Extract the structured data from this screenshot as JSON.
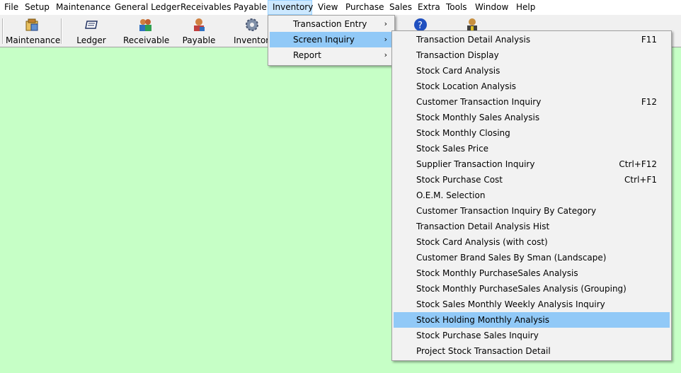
{
  "menubar": {
    "items": [
      "File",
      "Setup",
      "Maintenance",
      "General Ledger",
      "Receivables",
      "Payable",
      "Inventory",
      "View",
      "Purchase",
      "Sales",
      "Extra",
      "Tools",
      "Window",
      "Help"
    ],
    "active": "Inventory"
  },
  "toolbar": {
    "buttons": [
      {
        "label": "Maintenance",
        "icon": "maintenance-icon"
      },
      {
        "label": "Ledger",
        "icon": "ledger-icon"
      },
      {
        "label": "Receivable",
        "icon": "receivable-icon"
      },
      {
        "label": "Payable",
        "icon": "payable-icon"
      },
      {
        "label": "Inventory",
        "icon": "inventory-gear-icon"
      }
    ]
  },
  "inventory_menu": {
    "items": [
      {
        "label": "Transaction Entry",
        "submenu": true
      },
      {
        "label": "Screen Inquiry",
        "submenu": true,
        "highlighted": true
      },
      {
        "label": "Report",
        "submenu": true
      }
    ]
  },
  "screen_inquiry_menu": {
    "items": [
      {
        "label": "Transaction Detail Analysis",
        "shortcut": "F11"
      },
      {
        "label": "Transaction Display",
        "shortcut": ""
      },
      {
        "label": "Stock Card Analysis",
        "shortcut": ""
      },
      {
        "label": "Stock Location Analysis",
        "shortcut": ""
      },
      {
        "label": "Customer Transaction Inquiry",
        "shortcut": "F12"
      },
      {
        "label": "Stock Monthly Sales Analysis",
        "shortcut": ""
      },
      {
        "label": "Stock Monthly Closing",
        "shortcut": ""
      },
      {
        "label": "Stock Sales Price",
        "shortcut": ""
      },
      {
        "label": "Supplier Transaction Inquiry",
        "shortcut": "Ctrl+F12"
      },
      {
        "label": "Stock Purchase Cost",
        "shortcut": "Ctrl+F1"
      },
      {
        "label": "O.E.M. Selection",
        "shortcut": ""
      },
      {
        "label": "Customer Transaction Inquiry By Category",
        "shortcut": ""
      },
      {
        "label": "Transaction Detail Analysis Hist",
        "shortcut": ""
      },
      {
        "label": "Stock Card Analysis (with cost)",
        "shortcut": ""
      },
      {
        "label": "Customer Brand Sales By Sman (Landscape)",
        "shortcut": ""
      },
      {
        "label": "Stock Monthly PurchaseSales Analysis",
        "shortcut": ""
      },
      {
        "label": "Stock Monthly PurchaseSales Analysis (Grouping)",
        "shortcut": ""
      },
      {
        "label": "Stock Sales Monthly Weekly Analysis Inquiry",
        "shortcut": ""
      },
      {
        "label": "Stock Holding Monthly Analysis",
        "shortcut": "",
        "highlighted": true
      },
      {
        "label": "Stock Purchase Sales Inquiry",
        "shortcut": ""
      },
      {
        "label": "Project Stock Transaction Detail",
        "shortcut": ""
      }
    ]
  },
  "hidden_toolbar_icons": [
    "help-icon",
    "user-icon"
  ],
  "colors": {
    "workspace": "#c6ffc6",
    "highlight": "#91c9f7",
    "menubar_active": "#cce8ff"
  }
}
